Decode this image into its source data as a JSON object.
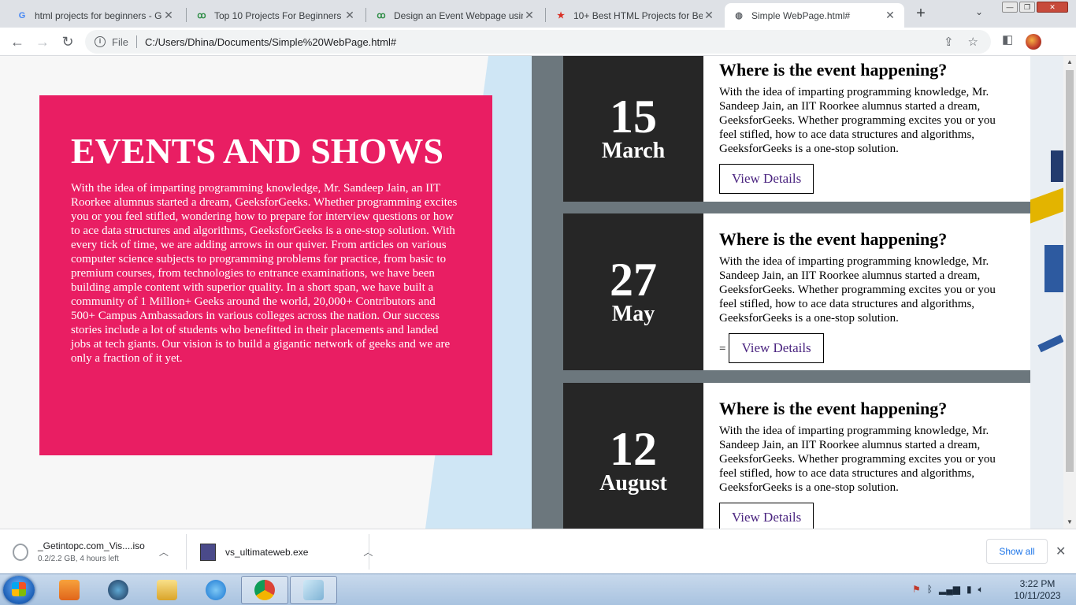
{
  "browser": {
    "tabs": [
      {
        "title": "html projects for beginners - G",
        "favicon": "google-icon",
        "active": false
      },
      {
        "title": "Top 10 Projects For Beginners T",
        "favicon": "gfg-icon",
        "active": false
      },
      {
        "title": "Design an Event Webpage usin",
        "favicon": "gfg-icon",
        "active": false
      },
      {
        "title": "10+ Best HTML Projects for Be",
        "favicon": "star-icon",
        "active": false
      },
      {
        "title": "Simple WebPage.html#",
        "favicon": "globe-icon",
        "active": true
      }
    ],
    "new_tab": "+",
    "address": {
      "scheme_label": "File",
      "url": "C:/Users/Dhina/Documents/Simple%20WebPage.html#"
    }
  },
  "page": {
    "hero": {
      "title": "EVENTS AND SHOWS",
      "body": "With the idea of imparting programming knowledge, Mr. Sandeep Jain, an IIT Roorkee alumnus started a dream, GeeksforGeeks. Whether programming excites you or you feel stifled, wondering how to prepare for interview questions or how to ace data structures and algorithms, GeeksforGeeks is a one-stop solution. With every tick of time, we are adding arrows in our quiver. From articles on various computer science subjects to programming problems for practice, from basic to premium courses, from technologies to entrance examinations, we have been building ample content with superior quality. In a short span, we have built a community of 1 Million+ Geeks around the world, 20,000+ Contributors and 500+ Campus Ambassadors in various colleges across the nation. Our success stories include a lot of students who benefitted in their placements and landed jobs at tech giants. Our vision is to build a gigantic network of geeks and we are only a fraction of it yet."
    },
    "events": [
      {
        "day": "15",
        "month": "March",
        "heading": "Where is the event happening?",
        "text": "With the idea of imparting programming knowledge, Mr. Sandeep Jain, an IIT Roorkee alumnus started a dream, GeeksforGeeks. Whether programming excites you or you feel stifled, how to ace data structures and algorithms, GeeksforGeeks is a one-stop solution.",
        "prefix": "",
        "button": "View Details"
      },
      {
        "day": "27",
        "month": "May",
        "heading": "Where is the event happening?",
        "text": "With the idea of imparting programming knowledge, Mr. Sandeep Jain, an IIT Roorkee alumnus started a dream, GeeksforGeeks. Whether programming excites you or you feel stifled, how to ace data structures and algorithms, GeeksforGeeks is a one-stop solution.",
        "prefix": "=",
        "button": "View Details"
      },
      {
        "day": "12",
        "month": "August",
        "heading": "Where is the event happening?",
        "text": "With the idea of imparting programming knowledge, Mr. Sandeep Jain, an IIT Roorkee alumnus started a dream, GeeksforGeeks. Whether programming excites you or you feel stifled, how to ace data structures and algorithms, GeeksforGeeks is a one-stop solution.",
        "prefix": "",
        "button": "View Details"
      }
    ],
    "colors": {
      "hero": "#e91e63",
      "date_block": "#262626",
      "button_text": "#4b2580",
      "side_bg": "#6c777d"
    }
  },
  "downloads": {
    "items": [
      {
        "name": "_Getintopc.com_Vis....iso",
        "status": "0.2/2.2 GB, 4 hours left"
      },
      {
        "name": "vs_ultimateweb.exe",
        "status": ""
      }
    ],
    "show_all": "Show all"
  },
  "taskbar": {
    "time": "3:22 PM",
    "date": "10/11/2023"
  }
}
